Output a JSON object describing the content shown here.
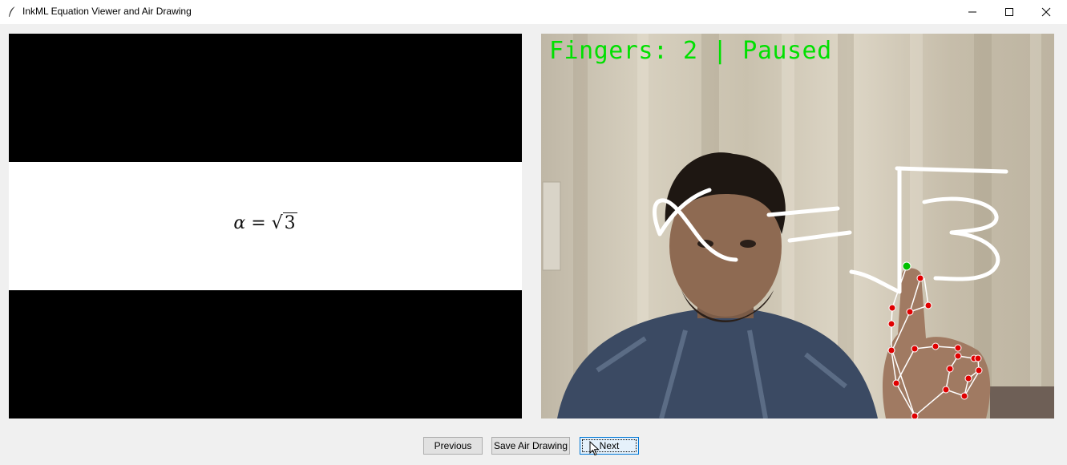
{
  "window": {
    "title": "InkML Equation Viewer and Air Drawing",
    "controls": [
      "minimize",
      "maximize",
      "close"
    ]
  },
  "equation_view": {
    "alpha": "α",
    "equals": " = ",
    "root_sign": "√",
    "radicand": "3"
  },
  "camera_view": {
    "overlay_text": "Fingers: 2 | Paused",
    "overlay_color": "#00e000",
    "landmark_color": "#e00000",
    "active_fingertip_color": "#00c000",
    "stroke_color": "#ffffff"
  },
  "buttons": {
    "previous": "Previous",
    "save": "Save Air Drawing",
    "next": "Next"
  },
  "icons": {
    "app": "feather-icon",
    "minimize": "minimize-icon",
    "maximize": "maximize-icon",
    "close": "close-icon"
  }
}
